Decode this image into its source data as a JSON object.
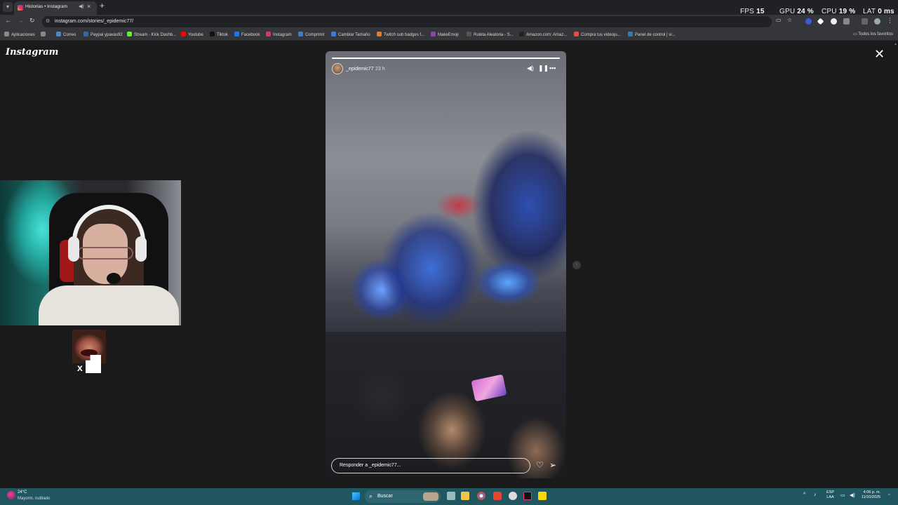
{
  "browser": {
    "tab_title": "Historias • Instagram",
    "url": "instagram.com/stories/_epidemic77/",
    "bookmarks": [
      {
        "label": "Aplicaciones",
        "color": "#4a4a4a"
      },
      {
        "label": "Correo",
        "color": "#4f86c6"
      },
      {
        "label": "Paypal ypavas92",
        "color": "#2b6cb0"
      },
      {
        "label": "Stream - Kick Dashb...",
        "color": "#53fc18"
      },
      {
        "label": "Youtube",
        "color": "#ff0000"
      },
      {
        "label": "Tiktok",
        "color": "#111111"
      },
      {
        "label": "Facebook",
        "color": "#1877f2"
      },
      {
        "label": "Instagram",
        "color": "#e1306c"
      },
      {
        "label": "Comprimir",
        "color": "#3a7bd5"
      },
      {
        "label": "Cambiar Tamaño",
        "color": "#3a7bd5"
      },
      {
        "label": "Twitch sub badges f...",
        "color": "#e67e22"
      },
      {
        "label": "MakeEmoji",
        "color": "#8e44ad"
      },
      {
        "label": "Ruleta Aleatoria - S...",
        "color": "#555555"
      },
      {
        "label": "Amazon.com: Amaz...",
        "color": "#222222"
      },
      {
        "label": "Compra tus videoju...",
        "color": "#e74c3c"
      },
      {
        "label": "Panel de control | vi...",
        "color": "#2980b9"
      }
    ],
    "all_favorites": "Todos los favoritos"
  },
  "overlay": {
    "fps_label": "FPS",
    "fps_value": "15",
    "gpu_label": "GPU",
    "gpu_value": "24 %",
    "cpu_label": "CPU",
    "cpu_value": "19 %",
    "lat_label": "LAT",
    "lat_value": "0 ms"
  },
  "instagram": {
    "logo": "Instagram",
    "story": {
      "username": "_epidemic77",
      "time": "23 h",
      "reply_placeholder": "Responder a _epidemic77...",
      "progress": 1.0
    }
  },
  "taskbar": {
    "weather_temp": "24°C",
    "weather_desc": "Mayorm. nublado",
    "search_label": "Buscar",
    "lang_line1": "ESP",
    "lang_line2": "LAA",
    "time": "4:06 p. m.",
    "date": "11/10/2025"
  },
  "icons": [
    "instagram-icon",
    "close-icon",
    "mute-icon",
    "pause-icon",
    "more-icon",
    "heart-icon",
    "share-icon",
    "search-icon",
    "windows-icon"
  ]
}
